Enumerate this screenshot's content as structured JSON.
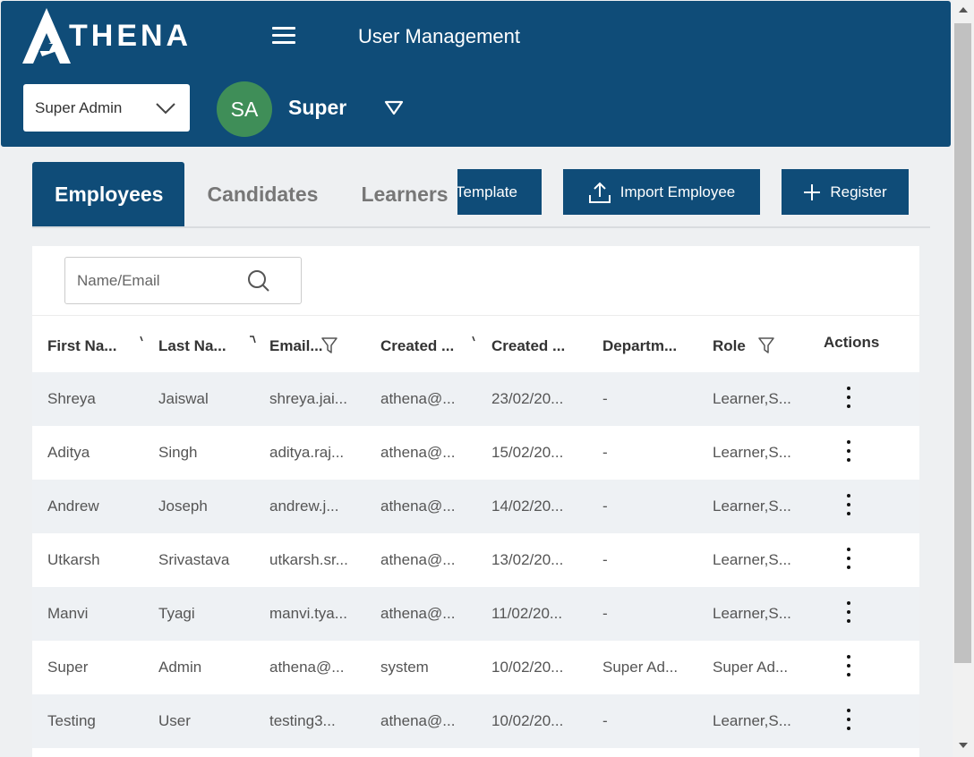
{
  "header": {
    "logo_text": "THENA",
    "page_title": "User Management",
    "role_select": "Super Admin",
    "avatar_initials": "SA",
    "user_name": "Super",
    "color": "#0f4c78"
  },
  "tabs": [
    {
      "label": "Employees",
      "active": true
    },
    {
      "label": "Candidates",
      "active": false
    },
    {
      "label": "Learners",
      "active": false
    }
  ],
  "buttons": {
    "template": "Template",
    "import": "Import Employee",
    "register": "Register"
  },
  "search": {
    "placeholder": "Name/Email",
    "value": ""
  },
  "table": {
    "columns": [
      "First Na...",
      "Last Na...",
      "Email...",
      "Created ...",
      "Created ...",
      "Departm...",
      "Role",
      "Actions"
    ],
    "rows": [
      [
        "Shreya",
        "Jaiswal",
        "shreya.jai...",
        "athena@...",
        "23/02/20...",
        "-",
        "Learner,S..."
      ],
      [
        "Aditya",
        "Singh",
        "aditya.raj...",
        "athena@...",
        "15/02/20...",
        "-",
        "Learner,S..."
      ],
      [
        "Andrew",
        "Joseph",
        "andrew.j...",
        "athena@...",
        "14/02/20...",
        "-",
        "Learner,S..."
      ],
      [
        "Utkarsh",
        "Srivastava",
        "utkarsh.sr...",
        "athena@...",
        "13/02/20...",
        "-",
        "Learner,S..."
      ],
      [
        "Manvi",
        "Tyagi",
        "manvi.tya...",
        "athena@...",
        "11/02/20...",
        "-",
        "Learner,S..."
      ],
      [
        "Super",
        "Admin",
        "athena@...",
        "system",
        "10/02/20...",
        "Super Ad...",
        "Super Ad..."
      ],
      [
        "Testing",
        "User",
        "testing3...",
        "athena@...",
        "10/02/20...",
        "-",
        "Learner,S..."
      ]
    ]
  },
  "icons": {
    "menu": "hamburger-icon",
    "dropdown": "chevron-down-icon",
    "user_menu": "triangle-down-icon",
    "upload": "upload-icon",
    "plus": "plus-icon",
    "search": "search-icon",
    "filter": "filter-icon",
    "sort": "sort-icon",
    "row_actions": "kebab-menu-icon"
  }
}
